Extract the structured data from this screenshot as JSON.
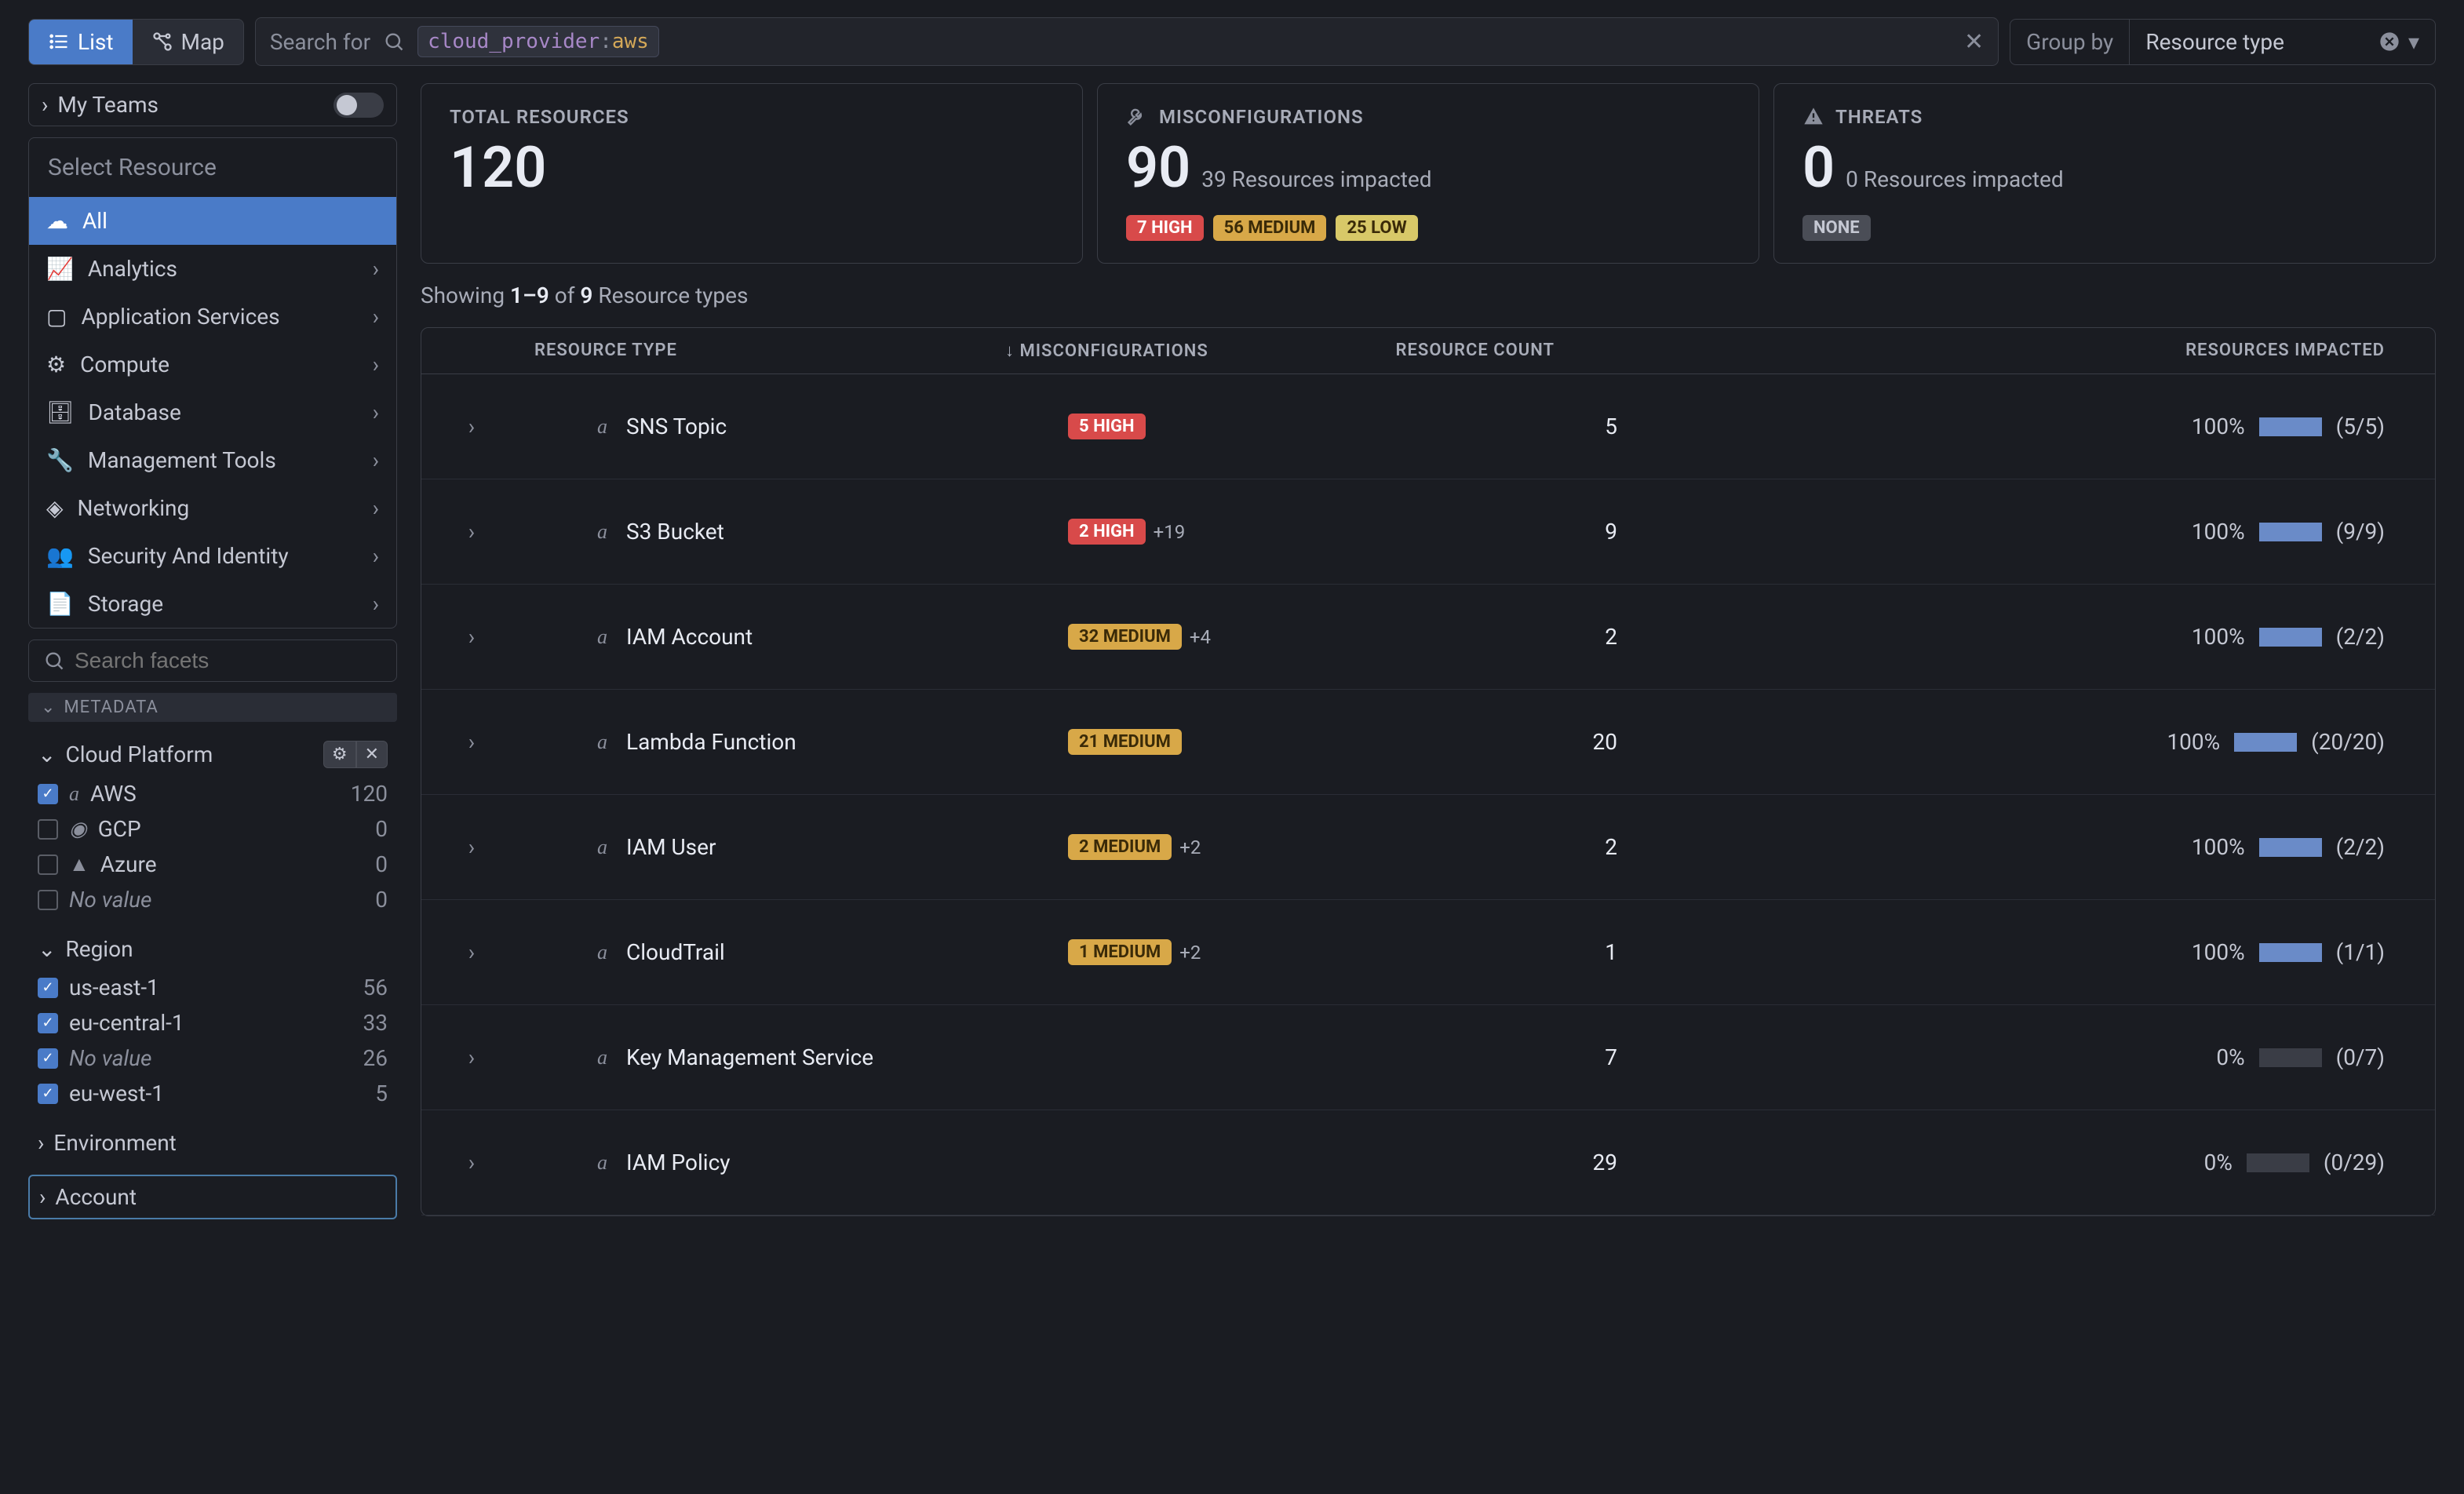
{
  "topbar": {
    "list_label": "List",
    "map_label": "Map",
    "search_label": "Search for",
    "search_chip_key": "cloud_provider",
    "search_chip_val": "aws",
    "groupby_label": "Group by",
    "groupby_value": "Resource type"
  },
  "sidebar": {
    "my_teams": "My Teams",
    "select_resource": "Select Resource",
    "resources": [
      {
        "label": "All",
        "active": true,
        "chevron": false
      },
      {
        "label": "Analytics",
        "active": false,
        "chevron": true
      },
      {
        "label": "Application Services",
        "active": false,
        "chevron": true
      },
      {
        "label": "Compute",
        "active": false,
        "chevron": true
      },
      {
        "label": "Database",
        "active": false,
        "chevron": true
      },
      {
        "label": "Management Tools",
        "active": false,
        "chevron": true
      },
      {
        "label": "Networking",
        "active": false,
        "chevron": true
      },
      {
        "label": "Security And Identity",
        "active": false,
        "chevron": true
      },
      {
        "label": "Storage",
        "active": false,
        "chevron": true
      }
    ],
    "facet_search_placeholder": "Search facets",
    "metadata_label": "METADATA",
    "cloud_platform": {
      "title": "Cloud Platform",
      "items": [
        {
          "label": "AWS",
          "count": "120",
          "checked": true
        },
        {
          "label": "GCP",
          "count": "0",
          "checked": false
        },
        {
          "label": "Azure",
          "count": "0",
          "checked": false
        },
        {
          "label": "No value",
          "count": "0",
          "checked": false,
          "italic": true
        }
      ]
    },
    "region": {
      "title": "Region",
      "items": [
        {
          "label": "us-east-1",
          "count": "56",
          "checked": true
        },
        {
          "label": "eu-central-1",
          "count": "33",
          "checked": true
        },
        {
          "label": "No value",
          "count": "26",
          "checked": true,
          "italic": true
        },
        {
          "label": "eu-west-1",
          "count": "5",
          "checked": true
        }
      ]
    },
    "environment_label": "Environment",
    "account_label": "Account"
  },
  "cards": {
    "total": {
      "title": "TOTAL RESOURCES",
      "value": "120"
    },
    "misc": {
      "title": "MISCONFIGURATIONS",
      "value": "90",
      "sub": "39 Resources impacted",
      "high": "7 HIGH",
      "med": "56 MEDIUM",
      "low": "25 LOW"
    },
    "threats": {
      "title": "THREATS",
      "value": "0",
      "sub": "0 Resources impacted",
      "none": "NONE"
    }
  },
  "showing": {
    "prefix": "Showing ",
    "range": "1–9",
    "of": " of ",
    "total": "9",
    "suffix": " Resource types"
  },
  "columns": {
    "type": "RESOURCE TYPE",
    "misc": "MISCONFIGURATIONS",
    "count": "RESOURCE COUNT",
    "imp": "RESOURCES IMPACTED"
  },
  "rows": [
    {
      "name": "SNS Topic",
      "badge_text": "5 HIGH",
      "badge_class": "high",
      "extra": "",
      "count": "5",
      "pct": "100%",
      "frac": "(5/5)",
      "bar": 100
    },
    {
      "name": "S3 Bucket",
      "badge_text": "2 HIGH",
      "badge_class": "high",
      "extra": "+19",
      "count": "9",
      "pct": "100%",
      "frac": "(9/9)",
      "bar": 100
    },
    {
      "name": "IAM Account",
      "badge_text": "32 MEDIUM",
      "badge_class": "medium",
      "extra": "+4",
      "count": "2",
      "pct": "100%",
      "frac": "(2/2)",
      "bar": 100
    },
    {
      "name": "Lambda Function",
      "badge_text": "21 MEDIUM",
      "badge_class": "medium",
      "extra": "",
      "count": "20",
      "pct": "100%",
      "frac": "(20/20)",
      "bar": 100
    },
    {
      "name": "IAM User",
      "badge_text": "2 MEDIUM",
      "badge_class": "medium",
      "extra": "+2",
      "count": "2",
      "pct": "100%",
      "frac": "(2/2)",
      "bar": 100
    },
    {
      "name": "CloudTrail",
      "badge_text": "1 MEDIUM",
      "badge_class": "medium",
      "extra": "+2",
      "count": "1",
      "pct": "100%",
      "frac": "(1/1)",
      "bar": 100
    },
    {
      "name": "Key Management Service",
      "badge_text": "",
      "badge_class": "",
      "extra": "",
      "count": "7",
      "pct": "0%",
      "frac": "(0/7)",
      "bar": 0
    },
    {
      "name": "IAM Policy",
      "badge_text": "",
      "badge_class": "",
      "extra": "",
      "count": "29",
      "pct": "0%",
      "frac": "(0/29)",
      "bar": 0
    }
  ]
}
